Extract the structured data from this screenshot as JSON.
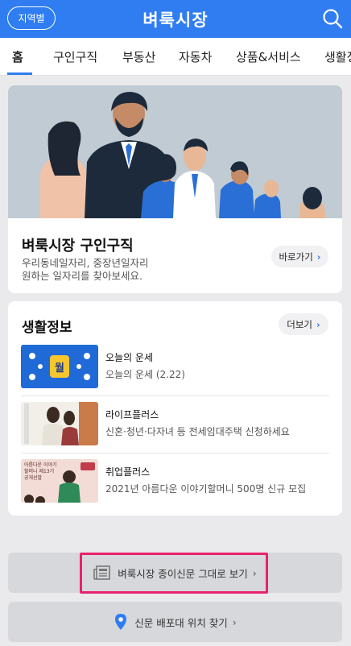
{
  "header": {
    "region_button": "지역별",
    "title": "벼룩시장",
    "search_icon": "search-icon"
  },
  "tabs": [
    "홈",
    "구인구직",
    "부동산",
    "자동차",
    "상품&서비스",
    "생활정"
  ],
  "hero": {
    "title": "벼룩시장 구인구직",
    "desc_line1": "우리동네일자리, 중장년일자리",
    "desc_line2": "원하는 일자리를 찾아보세요.",
    "button": "바로가기"
  },
  "life_info": {
    "title": "생활정보",
    "more_button": "더보기",
    "items": [
      {
        "name": "오늘의 운세",
        "desc": "오늘의 운세 (2.22)",
        "thumb_text": "월"
      },
      {
        "name": "라이프플러스",
        "desc": "신혼·청년·다자녀 등 전세임대주택 신청하세요"
      },
      {
        "name": "취업플러스",
        "desc": "2021년 아름다운 이야기할머니 500명 신규 모집",
        "thumb_text": "아름다운 이야기할머니 제13기 공개선발"
      }
    ]
  },
  "buttons": {
    "newspaper": "벼룩시장 종이신문 그대로 보기",
    "newspaper_icon": "newspaper-icon",
    "distribution": "신문 배포대 위치 찾기",
    "distribution_icon": "location-pin-icon"
  },
  "colors": {
    "brand_blue": "#2f7df1",
    "highlight_pink": "#e9216d"
  }
}
